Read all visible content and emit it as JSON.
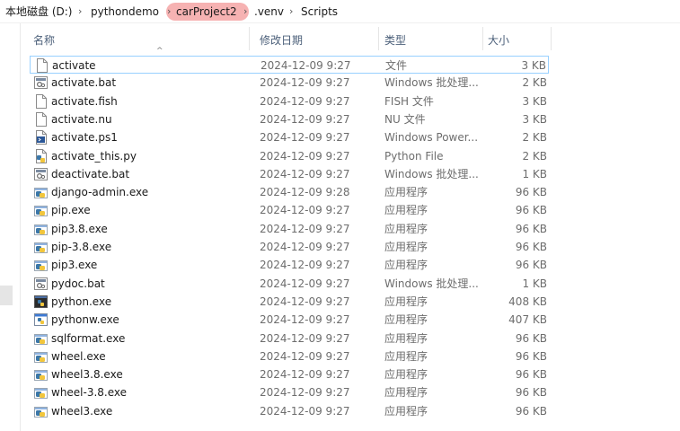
{
  "breadcrumb": {
    "items": [
      "本地磁盘 (D:)",
      "pythondemo",
      "carProject2",
      ".venv",
      "Scripts"
    ],
    "separator": "›"
  },
  "columns": {
    "name": "名称",
    "date": "修改日期",
    "type": "类型",
    "size": "大小"
  },
  "colors": {
    "highlight": "#f4a4a4",
    "selected_border": "#99d1ff",
    "header_text": "#4c607a"
  },
  "files": [
    {
      "name": "activate",
      "date": "2024-12-09 9:27",
      "type": "文件",
      "size": "3 KB",
      "icon": "blank-file-icon",
      "selected": true
    },
    {
      "name": "activate.bat",
      "date": "2024-12-09 9:27",
      "type": "Windows 批处理...",
      "size": "2 KB",
      "icon": "batch-file-icon"
    },
    {
      "name": "activate.fish",
      "date": "2024-12-09 9:27",
      "type": "FISH 文件",
      "size": "3 KB",
      "icon": "blank-file-icon"
    },
    {
      "name": "activate.nu",
      "date": "2024-12-09 9:27",
      "type": "NU 文件",
      "size": "3 KB",
      "icon": "blank-file-icon"
    },
    {
      "name": "activate.ps1",
      "date": "2024-12-09 9:27",
      "type": "Windows Power...",
      "size": "2 KB",
      "icon": "powershell-file-icon"
    },
    {
      "name": "activate_this.py",
      "date": "2024-12-09 9:27",
      "type": "Python File",
      "size": "2 KB",
      "icon": "python-file-icon"
    },
    {
      "name": "deactivate.bat",
      "date": "2024-12-09 9:27",
      "type": "Windows 批处理...",
      "size": "1 KB",
      "icon": "batch-file-icon"
    },
    {
      "name": "django-admin.exe",
      "date": "2024-12-09 9:28",
      "type": "应用程序",
      "size": "96 KB",
      "icon": "python-exe-icon"
    },
    {
      "name": "pip.exe",
      "date": "2024-12-09 9:27",
      "type": "应用程序",
      "size": "96 KB",
      "icon": "python-exe-icon"
    },
    {
      "name": "pip3.8.exe",
      "date": "2024-12-09 9:27",
      "type": "应用程序",
      "size": "96 KB",
      "icon": "python-exe-icon"
    },
    {
      "name": "pip-3.8.exe",
      "date": "2024-12-09 9:27",
      "type": "应用程序",
      "size": "96 KB",
      "icon": "python-exe-icon"
    },
    {
      "name": "pip3.exe",
      "date": "2024-12-09 9:27",
      "type": "应用程序",
      "size": "96 KB",
      "icon": "python-exe-icon"
    },
    {
      "name": "pydoc.bat",
      "date": "2024-12-09 9:27",
      "type": "Windows 批处理...",
      "size": "1 KB",
      "icon": "batch-file-icon"
    },
    {
      "name": "python.exe",
      "date": "2024-12-09 9:27",
      "type": "应用程序",
      "size": "408 KB",
      "icon": "python-console-icon"
    },
    {
      "name": "pythonw.exe",
      "date": "2024-12-09 9:27",
      "type": "应用程序",
      "size": "407 KB",
      "icon": "python-window-icon"
    },
    {
      "name": "sqlformat.exe",
      "date": "2024-12-09 9:27",
      "type": "应用程序",
      "size": "96 KB",
      "icon": "python-exe-icon"
    },
    {
      "name": "wheel.exe",
      "date": "2024-12-09 9:27",
      "type": "应用程序",
      "size": "96 KB",
      "icon": "python-exe-icon"
    },
    {
      "name": "wheel3.8.exe",
      "date": "2024-12-09 9:27",
      "type": "应用程序",
      "size": "96 KB",
      "icon": "python-exe-icon"
    },
    {
      "name": "wheel-3.8.exe",
      "date": "2024-12-09 9:27",
      "type": "应用程序",
      "size": "96 KB",
      "icon": "python-exe-icon"
    },
    {
      "name": "wheel3.exe",
      "date": "2024-12-09 9:27",
      "type": "应用程序",
      "size": "96 KB",
      "icon": "python-exe-icon"
    }
  ]
}
